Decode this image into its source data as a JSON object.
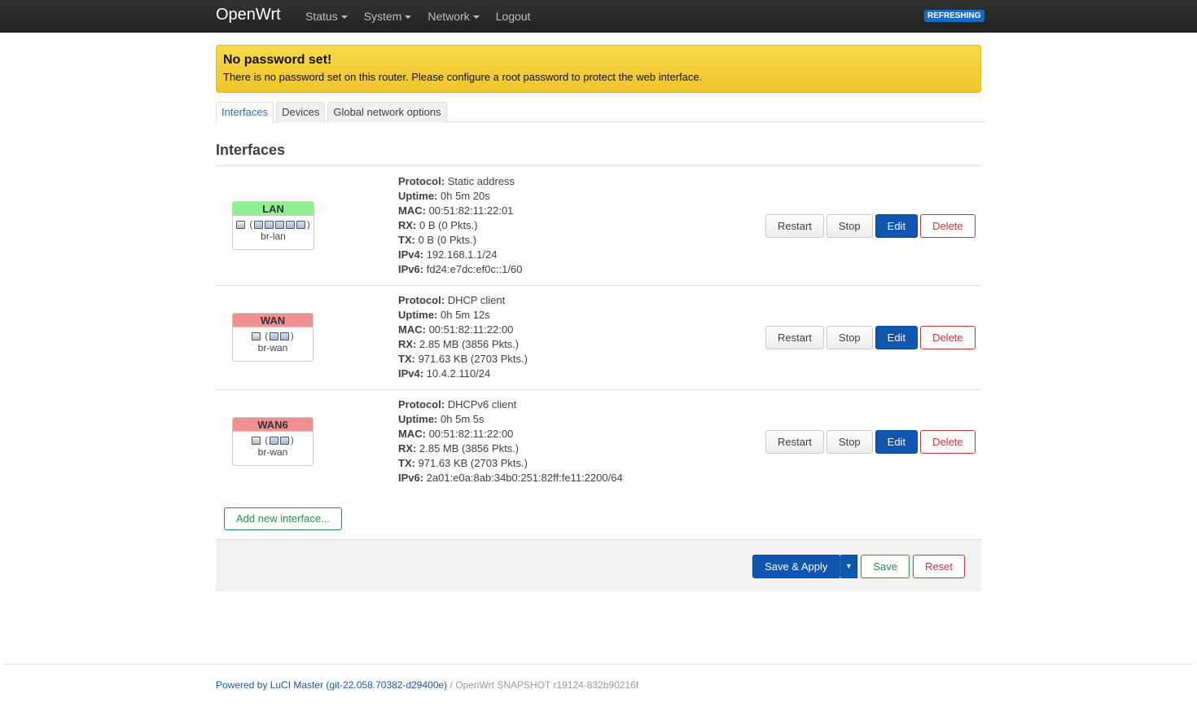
{
  "navbar": {
    "brand": "OpenWrt",
    "menu": [
      {
        "label": "Status",
        "dropdown": true
      },
      {
        "label": "System",
        "dropdown": true
      },
      {
        "label": "Network",
        "dropdown": true
      },
      {
        "label": "Logout",
        "dropdown": false
      }
    ],
    "indicator": "REFRESHING"
  },
  "alert": {
    "title": "No password set!",
    "message": "There is no password set on this router. Please configure a root password to protect the web interface."
  },
  "tabs": [
    {
      "label": "Interfaces",
      "active": true
    },
    {
      "label": "Devices",
      "active": false
    },
    {
      "label": "Global network options",
      "active": false
    }
  ],
  "section": {
    "title": "Interfaces"
  },
  "interfaces": [
    {
      "name": "LAN",
      "device": "br-lan",
      "color": "#90f090",
      "details": [
        {
          "key": "Protocol:",
          "value": "Static address"
        },
        {
          "key": "Uptime:",
          "value": "0h 5m 20s"
        },
        {
          "key": "MAC:",
          "value": "00:51:82:11:22:01"
        },
        {
          "key": "RX:",
          "value": "0 B (0 Pkts.)"
        },
        {
          "key": "TX:",
          "value": "0 B (0 Pkts.)"
        },
        {
          "key": "IPv4:",
          "value": "192.168.1.1/24"
        },
        {
          "key": "IPv6:",
          "value": "fd24:e7dc:ef0c::1/60"
        }
      ]
    },
    {
      "name": "WAN",
      "device": "br-wan",
      "color": "#f09090",
      "details": [
        {
          "key": "Protocol:",
          "value": "DHCP client"
        },
        {
          "key": "Uptime:",
          "value": "0h 5m 12s"
        },
        {
          "key": "MAC:",
          "value": "00:51:82:11:22:00"
        },
        {
          "key": "RX:",
          "value": "2.85 MB (3856 Pkts.)"
        },
        {
          "key": "TX:",
          "value": "971.63 KB (2703 Pkts.)"
        },
        {
          "key": "IPv4:",
          "value": "10.4.2.110/24"
        }
      ]
    },
    {
      "name": "WAN6",
      "device": "br-wan",
      "color": "#f09090",
      "details": [
        {
          "key": "Protocol:",
          "value": "DHCPv6 client"
        },
        {
          "key": "Uptime:",
          "value": "0h 5m 5s"
        },
        {
          "key": "MAC:",
          "value": "00:51:82:11:22:00"
        },
        {
          "key": "RX:",
          "value": "2.85 MB (3856 Pkts.)"
        },
        {
          "key": "TX:",
          "value": "971.63 KB (2703 Pkts.)"
        },
        {
          "key": "IPv6:",
          "value": "2a01:e0a:8ab:34b0:251:82ff:fe11:2200/64"
        }
      ]
    }
  ],
  "row_actions": {
    "restart": "Restart",
    "stop": "Stop",
    "edit": "Edit",
    "delete": "Delete"
  },
  "add_interface_label": "Add new interface...",
  "actionbar": {
    "save_apply": "Save & Apply",
    "dropdown": "▾",
    "save": "Save",
    "reset": "Reset"
  },
  "footer": {
    "luci_link": "Powered by LuCI Master (git-22.058.70382-d29400e)",
    "separator": " / ",
    "version": "OpenWrt SNAPSHOT r19124-832b90216f"
  }
}
